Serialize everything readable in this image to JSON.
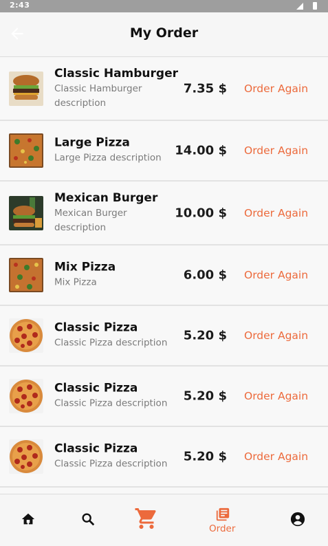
{
  "status_bar": {
    "time": "2:43"
  },
  "appbar": {
    "title": "My Order",
    "back_icon": "arrow-left-icon"
  },
  "orders": [
    {
      "name": "Classic Hamburger",
      "description": "Classic Hamburger description",
      "price": "7.35 $",
      "action": "Order Again",
      "image": "hamburger"
    },
    {
      "name": "Large Pizza",
      "description": "Large Pizza description",
      "price": "14.00 $",
      "action": "Order Again",
      "image": "veggie-pizza"
    },
    {
      "name": "Mexican Burger",
      "description": "Mexican Burger description",
      "price": "10.00 $",
      "action": "Order Again",
      "image": "burger-platter"
    },
    {
      "name": "Mix Pizza",
      "description": "Mix Pizza",
      "price": "6.00 $",
      "action": "Order Again",
      "image": "veggie-pizza"
    },
    {
      "name": "Classic Pizza",
      "description": "Classic Pizza description",
      "price": "5.20 $",
      "action": "Order Again",
      "image": "pepperoni-pizza"
    },
    {
      "name": "Classic Pizza",
      "description": "Classic Pizza description",
      "price": "5.20 $",
      "action": "Order Again",
      "image": "pepperoni-pizza"
    },
    {
      "name": "Classic Pizza",
      "description": "Classic Pizza description",
      "price": "5.20 $",
      "action": "Order Again",
      "image": "pepperoni-pizza"
    }
  ],
  "bottom_nav": {
    "items": [
      {
        "icon": "home-icon"
      },
      {
        "icon": "search-icon"
      },
      {
        "icon": "cart-icon"
      },
      {
        "icon": "order-list-icon",
        "label": "Order"
      },
      {
        "icon": "account-icon"
      }
    ]
  },
  "colors": {
    "accent": "#ec6a3c",
    "text": "#111111",
    "muted": "#7a7a7a"
  }
}
